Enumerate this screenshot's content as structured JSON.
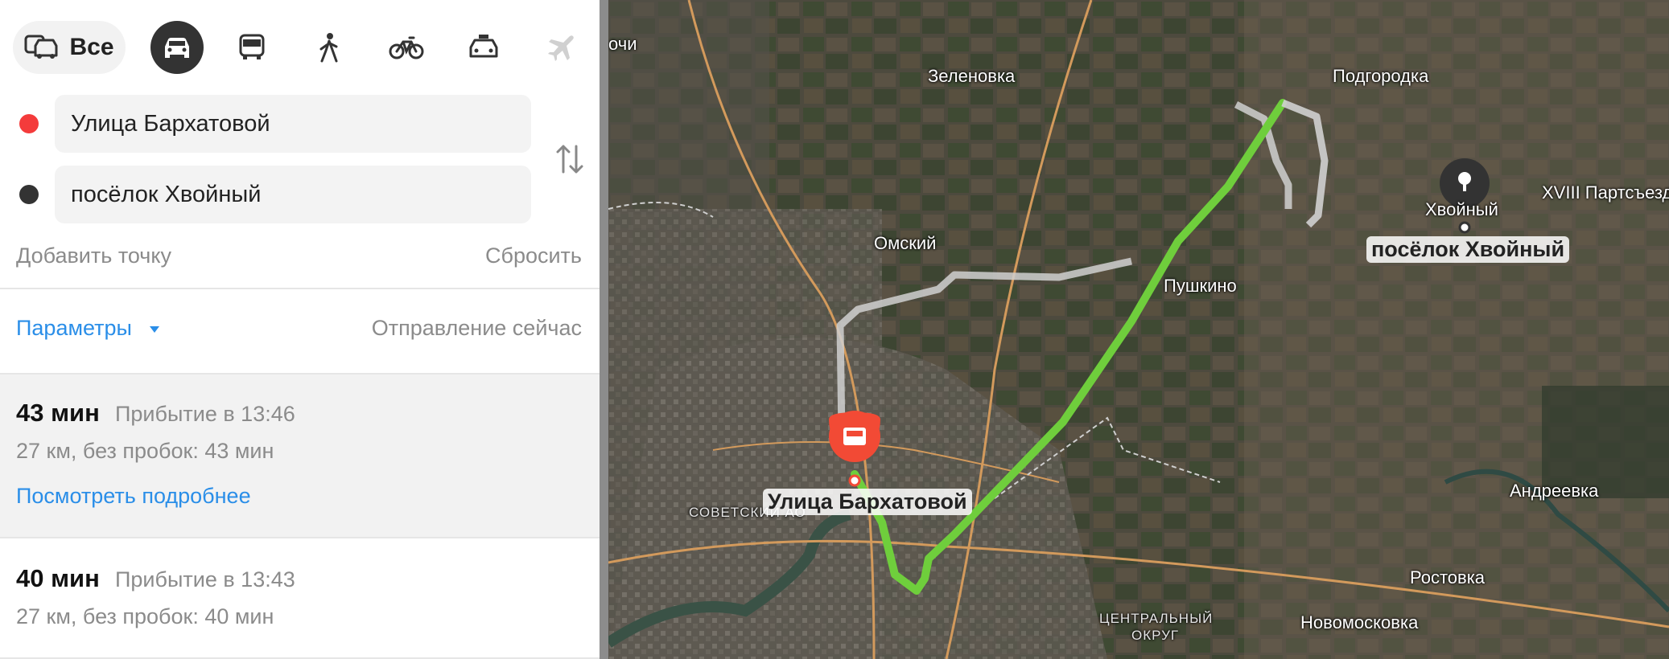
{
  "modes": {
    "all_label": "Все",
    "items": [
      {
        "name": "all-modes",
        "icon": "car-bus-icon"
      },
      {
        "name": "car",
        "icon": "car-icon",
        "selected": true
      },
      {
        "name": "public-transport",
        "icon": "bus-icon"
      },
      {
        "name": "walk",
        "icon": "pedestrian-icon"
      },
      {
        "name": "bicycle",
        "icon": "bicycle-icon"
      },
      {
        "name": "taxi",
        "icon": "taxi-icon"
      },
      {
        "name": "plane",
        "icon": "plane-icon",
        "disabled": true
      }
    ]
  },
  "route_form": {
    "from_value": "Улица Бархатовой",
    "to_value": "посёлок Хвойный",
    "from_dot_color": "#f43b3b",
    "to_dot_color": "#333333",
    "add_point_label": "Добавить точку",
    "reset_label": "Сбросить"
  },
  "options": {
    "params_label": "Параметры",
    "departure_label": "Отправление сейчас"
  },
  "routes": [
    {
      "duration": "43 мин",
      "arrival": "Прибытие в 13:46",
      "details": "27 км, без пробок: 43 мин",
      "more_label": "Посмотреть подробнее",
      "selected": true
    },
    {
      "duration": "40 мин",
      "arrival": "Прибытие в 13:43",
      "details": "27 км, без пробок: 40 мин"
    }
  ],
  "map": {
    "labels": {
      "zelenovka": "Зеленовка",
      "podgorodka": "Подгородка",
      "omsky": "Омский",
      "pushkino": "Пушкино",
      "khvoyny": "Хвойный",
      "xviii": "XVIII Партсъезд",
      "andreevka": "Андреевка",
      "rostovka": "Ростовка",
      "novomoskovka": "Новомосковка",
      "sovetsky": "СОВЕТСКИЙ АО",
      "central_1": "ЦЕНТРАЛЬНЫЙ",
      "central_2": "ОКРУГ",
      "ochi": "очи",
      "start": "Улица Бархатовой",
      "end": "посёлок Хвойный"
    },
    "colors": {
      "route_active": "#6fce3c",
      "route_alt": "#c8c8c8",
      "start_marker": "#f24a35",
      "end_marker": "#333333",
      "roads": "#d39a5c"
    }
  }
}
